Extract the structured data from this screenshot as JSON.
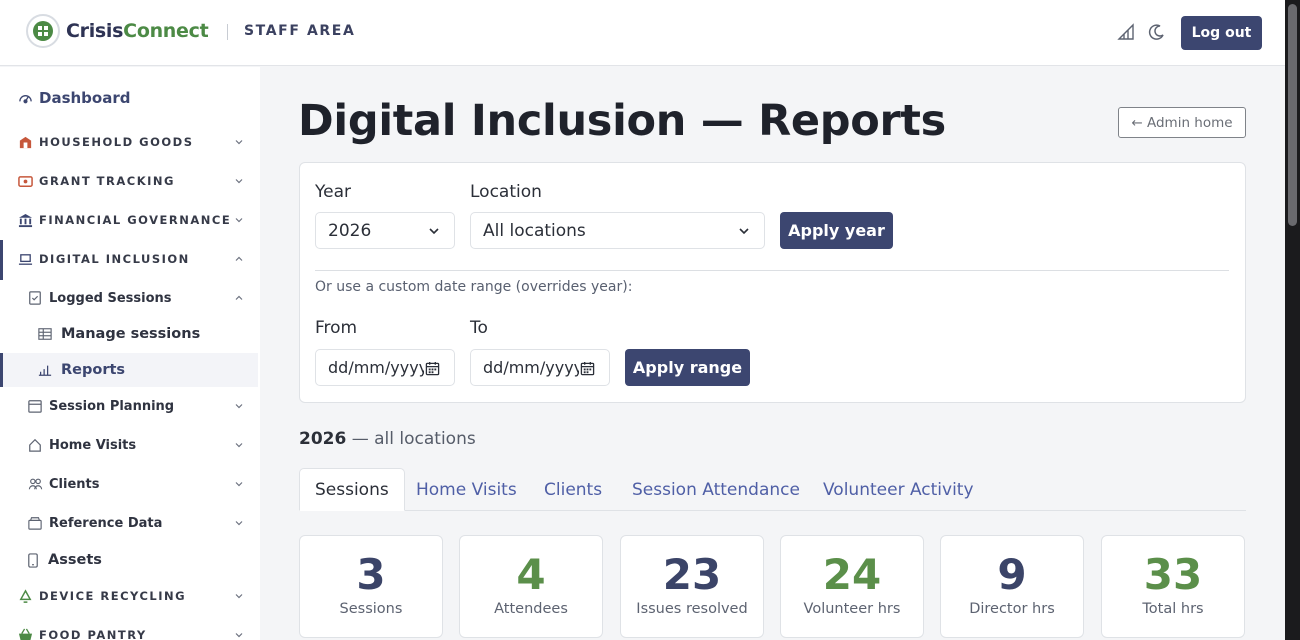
{
  "header": {
    "brand_first": "Crisis",
    "brand_second": "Connect",
    "area_label": "STAFF AREA",
    "icons": [
      "chart-icon",
      "moon-icon"
    ],
    "logout_label": "Log out"
  },
  "sidebar": {
    "dashboard": "Dashboard",
    "household_goods": "HOUSEHOLD GOODS",
    "grant_tracking": "GRANT TRACKING",
    "financial_governance": "FINANCIAL GOVERNANCE",
    "digital_inclusion": "DIGITAL INCLUSION",
    "logged_sessions": "Logged Sessions",
    "manage_sessions": "Manage sessions",
    "reports": "Reports",
    "session_planning": "Session Planning",
    "home_visits": "Home Visits",
    "clients": "Clients",
    "reference_data": "Reference Data",
    "assets": "Assets",
    "device_recycling": "DEVICE RECYCLING",
    "food_pantry": "FOOD PANTRY"
  },
  "page": {
    "title": "Digital Inclusion — Reports",
    "admin_home": "← Admin home"
  },
  "filters": {
    "year_label": "Year",
    "year_value": "2026",
    "location_label": "Location",
    "location_value": "All locations",
    "apply_year": "Apply year",
    "custom_hint": "Or use a custom date range (overrides year):",
    "from_label": "From",
    "to_label": "To",
    "date_placeholder": "dd/mm/yyyy",
    "apply_range": "Apply range"
  },
  "summary": {
    "year": "2026",
    "rest": " — all locations"
  },
  "tabs": {
    "sessions": "Sessions",
    "home_visits": "Home Visits",
    "clients": "Clients",
    "session_attendance": "Session Attendance",
    "volunteer_activity": "Volunteer Activity"
  },
  "stats": [
    {
      "value": "3",
      "label": "Sessions",
      "color": "#3b4468"
    },
    {
      "value": "4",
      "label": "Attendees",
      "color": "#5b8f4a"
    },
    {
      "value": "23",
      "label": "Issues resolved",
      "color": "#3b4468"
    },
    {
      "value": "24",
      "label": "Volunteer hrs",
      "color": "#5b8f4a"
    },
    {
      "value": "9",
      "label": "Director hrs",
      "color": "#3b4468"
    },
    {
      "value": "33",
      "label": "Total hrs",
      "color": "#5b8f4a"
    }
  ],
  "colors": {
    "primary": "#3c4670",
    "accent_green": "#5b8f4a",
    "link": "#4f5fa6"
  }
}
